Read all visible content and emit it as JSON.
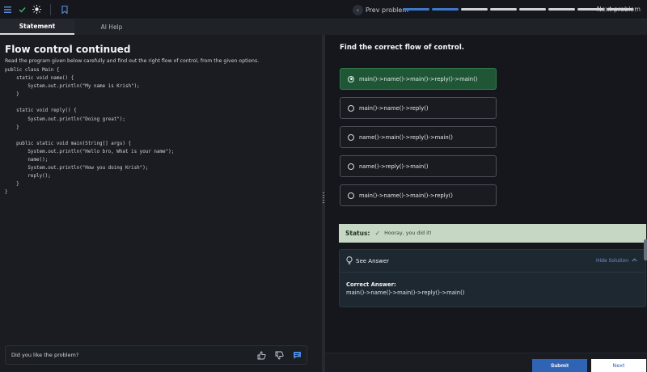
{
  "nav": {
    "prev_label": "Prev problem",
    "next_label": "Next problem",
    "progress": {
      "total": 8,
      "completed": 2
    }
  },
  "tabs": [
    {
      "label": "Statement",
      "active": true
    },
    {
      "label": "AI Help",
      "active": false
    }
  ],
  "problem": {
    "title": "Flow control continued",
    "description": "Read the program given below carefully and find out the right flow of control, from the given options.",
    "code": "public class Main {\n    static void name() {\n        System.out.println(\"My name is Krish\");\n    }\n\n    static void reply() {\n        System.out.println(\"Doing great\");\n    }\n\n    public static void main(String[] args) {\n        System.out.println(\"Hello bro, What is your name\");\n        name();\n        System.out.println(\"How you doing Krish\");\n        reply();\n    }\n}"
  },
  "feedback": {
    "prompt": "Did you like the problem?"
  },
  "question": {
    "title": "Find the correct flow of control.",
    "options": [
      {
        "label": "main()->name()->main()->reply()->main()",
        "selected": true
      },
      {
        "label": "main()->name()->reply()",
        "selected": false
      },
      {
        "label": "name()->main()->reply()->main()",
        "selected": false
      },
      {
        "label": "name()->reply()->main()",
        "selected": false
      },
      {
        "label": "main()->name()->main()->reply()",
        "selected": false
      }
    ]
  },
  "status": {
    "label": "Status:",
    "value": "Hooray, you did it!"
  },
  "answer": {
    "title": "See Answer",
    "hide_label": "Hide Solution",
    "correct_label": "Correct Answer:",
    "correct_value": "main()->name()->main()->reply()->main()"
  },
  "actions": {
    "submit": "Submit",
    "next": "Next"
  },
  "colors": {
    "accent": "#2f64b5",
    "success_bg": "#1f5736",
    "status_bg": "#c6d7c4",
    "progress_done": "#3f78c9"
  }
}
